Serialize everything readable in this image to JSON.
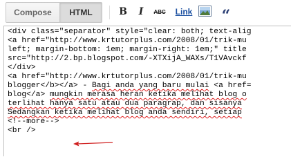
{
  "toolbar": {
    "compose_label": "Compose",
    "html_label": "HTML",
    "bold_label": "B",
    "italic_label": "I",
    "strike_label": "ABC",
    "link_label": "Link",
    "image_icon": "image-icon",
    "quote_icon": "quote-icon",
    "quote_glyph": "“"
  },
  "editor": {
    "lines": [
      "<div class=\"separator\" style=\"clear: both; text-alig",
      "<a href=\"http://www.krtutorplus.com/2008/01/trik-mu",
      "left; margin-bottom: 1em; margin-right: 1em;\" title",
      "src=\"http://2.bp.blogspot.com/-XTXijA_WAXs/T1VAvckf",
      "</div>",
      "<a href=\"http://www.krtutorplus.com/2008/01/trik-mu",
      "blogger</b></a> - ",
      "Bagi anda yang baru mulai",
      " <a href=",
      "blog</a> ",
      "mungkin merasa heran ketika melihat blog o",
      "terlihat hanya satu atau dua paragrap, dan sisanya",
      "Sedangkan ketika melihat blog anda sendiri, setiap",
      "<!--more-->",
      "<br />"
    ]
  },
  "colors": {
    "link": "#1a4fa0",
    "quote": "#2b3f74",
    "spellcheck": "#e02020",
    "arrow": "#d02020"
  }
}
